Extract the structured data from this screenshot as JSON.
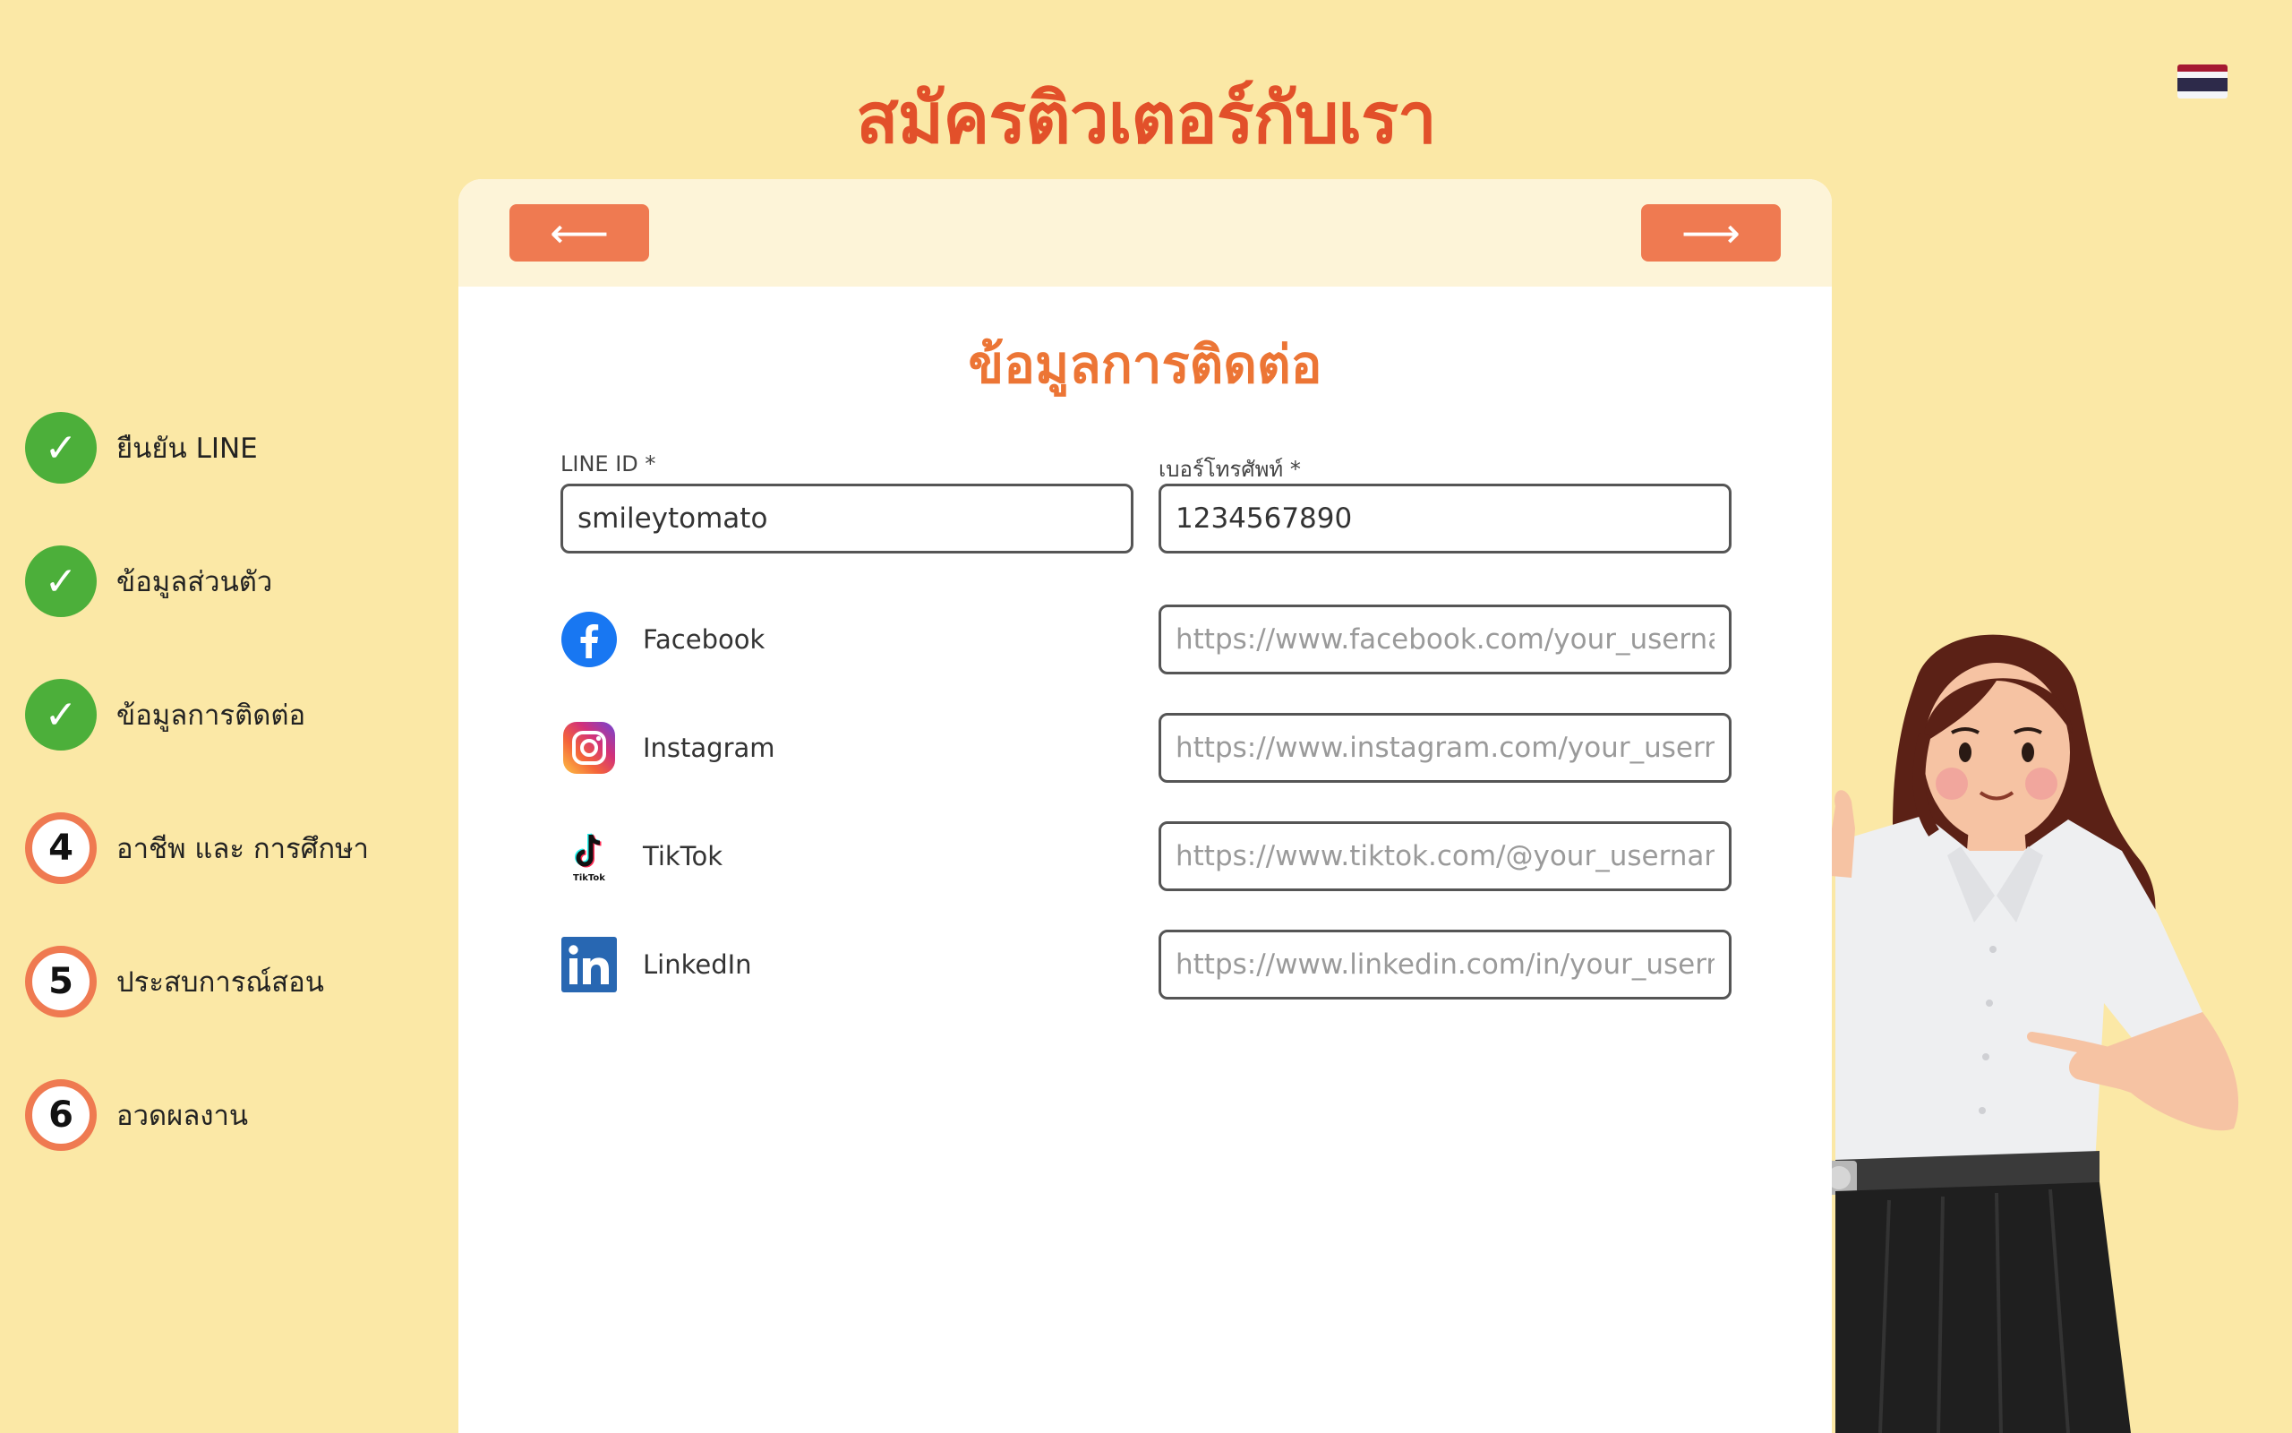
{
  "header": {
    "title": "สมัครติวเตอร์กับเรา",
    "language_flag": "thai-flag-icon"
  },
  "steps": [
    {
      "status": "done",
      "symbol": "✓",
      "label": "ยืนยัน LINE"
    },
    {
      "status": "done",
      "symbol": "✓",
      "label": "ข้อมูลส่วนตัว"
    },
    {
      "status": "done",
      "symbol": "✓",
      "label": "ข้อมูลการติดต่อ"
    },
    {
      "status": "todo",
      "symbol": "4",
      "label": "อาชีพ และ การศึกษา"
    },
    {
      "status": "todo",
      "symbol": "5",
      "label": "ประสบการณ์สอน"
    },
    {
      "status": "todo",
      "symbol": "6",
      "label": "อวดผลงาน"
    }
  ],
  "nav": {
    "prev_label": "⟵",
    "next_label": "⟶"
  },
  "form": {
    "section_title": "ข้อมูลการติดต่อ",
    "line_id": {
      "label": "LINE ID *",
      "value": "smileytomato"
    },
    "phone": {
      "label": "เบอร์โทรศัพท์ *",
      "value": "1234567890"
    },
    "socials": [
      {
        "name": "Facebook",
        "icon": "facebook-icon",
        "placeholder": "https://www.facebook.com/your_username"
      },
      {
        "name": "Instagram",
        "icon": "instagram-icon",
        "placeholder": "https://www.instagram.com/your_username"
      },
      {
        "name": "TikTok",
        "icon": "tiktok-icon",
        "placeholder": "https://www.tiktok.com/@your_username"
      },
      {
        "name": "LinkedIn",
        "icon": "linkedin-icon",
        "placeholder": "https://www.linkedin.com/in/your_username"
      }
    ]
  },
  "colors": {
    "background": "#fbe8a6",
    "title": "#e2502a",
    "accent": "#ef7a51",
    "done": "#4caf3a",
    "section_title": "#ec7535"
  },
  "tiktok_icon_caption": "TikTok"
}
